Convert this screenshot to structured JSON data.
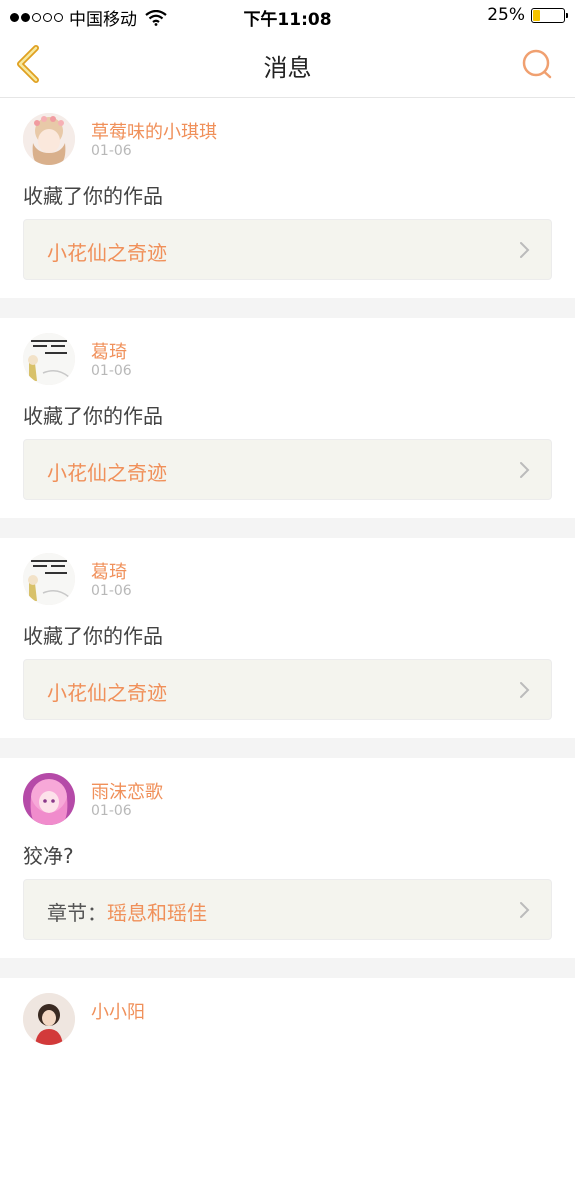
{
  "status_bar": {
    "carrier": "中国移动",
    "time": "下午11:08",
    "battery": "25%",
    "battery_level": 0.25,
    "signal_dots": [
      true,
      true,
      false,
      false,
      false
    ]
  },
  "nav": {
    "title": "消息",
    "back_icon": "chevron-left-icon",
    "search_icon": "search-icon",
    "accent_color": "#f0905a"
  },
  "messages": [
    {
      "username": "草莓味的小琪琪",
      "date": "01-06",
      "action": "收藏了你的作品",
      "work_prefix": "",
      "work_title": "小花仙之奇迹"
    },
    {
      "username": "葛琦",
      "date": "01-06",
      "action": "收藏了你的作品",
      "work_prefix": "",
      "work_title": "小花仙之奇迹"
    },
    {
      "username": "葛琦",
      "date": "01-06",
      "action": "收藏了你的作品",
      "work_prefix": "",
      "work_title": "小花仙之奇迹"
    },
    {
      "username": "雨沫恋歌",
      "date": "01-06",
      "action": "狡净?",
      "work_prefix": "章节：",
      "work_title": "瑶息和瑶佳"
    },
    {
      "username": "小小阳",
      "date": "",
      "action": "",
      "work_prefix": "",
      "work_title": ""
    }
  ]
}
